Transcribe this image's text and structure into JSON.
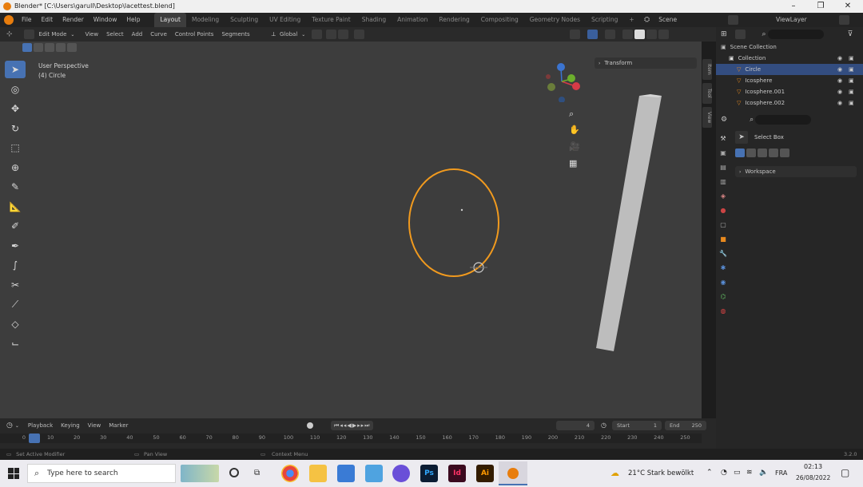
{
  "window": {
    "title": "Blender* [C:\\Users\\garull\\Desktop\\lacettest.blend]",
    "minimize": "–",
    "maximize": "❐",
    "close": "✕"
  },
  "top_menu": [
    "File",
    "Edit",
    "Render",
    "Window",
    "Help"
  ],
  "workspaces": [
    "Layout",
    "Modeling",
    "Sculpting",
    "UV Editing",
    "Texture Paint",
    "Shading",
    "Animation",
    "Rendering",
    "Compositing",
    "Geometry Nodes",
    "Scripting"
  ],
  "active_workspace": "Layout",
  "add_workspace": "+",
  "scene": {
    "label": "Scene",
    "view_layer": "ViewLayer"
  },
  "viewport_header": {
    "mode": "Edit Mode",
    "menus": [
      "View",
      "Select",
      "Add",
      "Curve",
      "Control Points",
      "Segments"
    ],
    "orientation": "Global"
  },
  "viewport": {
    "perspective": "User Perspective",
    "object": "(4) Circle",
    "panel_title": "Transform",
    "side_tabs": [
      "Item",
      "Tool",
      "View"
    ]
  },
  "timeline": {
    "menus": [
      "Playback",
      "Keying",
      "View",
      "Marker"
    ],
    "current_frame": "4",
    "start_label": "Start",
    "start": "1",
    "end_label": "End",
    "end": "250",
    "ticks": [
      "0",
      "10",
      "20",
      "30",
      "40",
      "50",
      "60",
      "70",
      "80",
      "90",
      "100",
      "110",
      "120",
      "130",
      "140",
      "150",
      "160",
      "170",
      "180",
      "190",
      "200",
      "210",
      "220",
      "230",
      "240",
      "250"
    ]
  },
  "status_bar": {
    "left": "Set Active Modifier",
    "middle": "Pan View",
    "right": "Context Menu",
    "version": "3.2.0"
  },
  "outliner": {
    "rows": [
      {
        "name": "Scene Collection",
        "indent": 0,
        "selected": false
      },
      {
        "name": "Collection",
        "indent": 1,
        "selected": false
      },
      {
        "name": "Circle",
        "indent": 2,
        "selected": true
      },
      {
        "name": "Icosphere",
        "indent": 2,
        "selected": false
      },
      {
        "name": "Icosphere.001",
        "indent": 2,
        "selected": false
      },
      {
        "name": "Icosphere.002",
        "indent": 2,
        "selected": false
      }
    ]
  },
  "properties": {
    "select_box": "Select Box",
    "workspace": "Workspace"
  },
  "taskbar": {
    "search_placeholder": "Type here to search",
    "weather": "21°C  Stark bewölkt",
    "language": "FRA",
    "time": "02:13",
    "date": "26/08/2022",
    "apps": [
      "Ps",
      "Id",
      "Ai"
    ]
  },
  "colors": {
    "accent_blue": "#4772b3",
    "selection_orange": "#f19a1e",
    "viewport_bg": "#3d3d3d"
  }
}
